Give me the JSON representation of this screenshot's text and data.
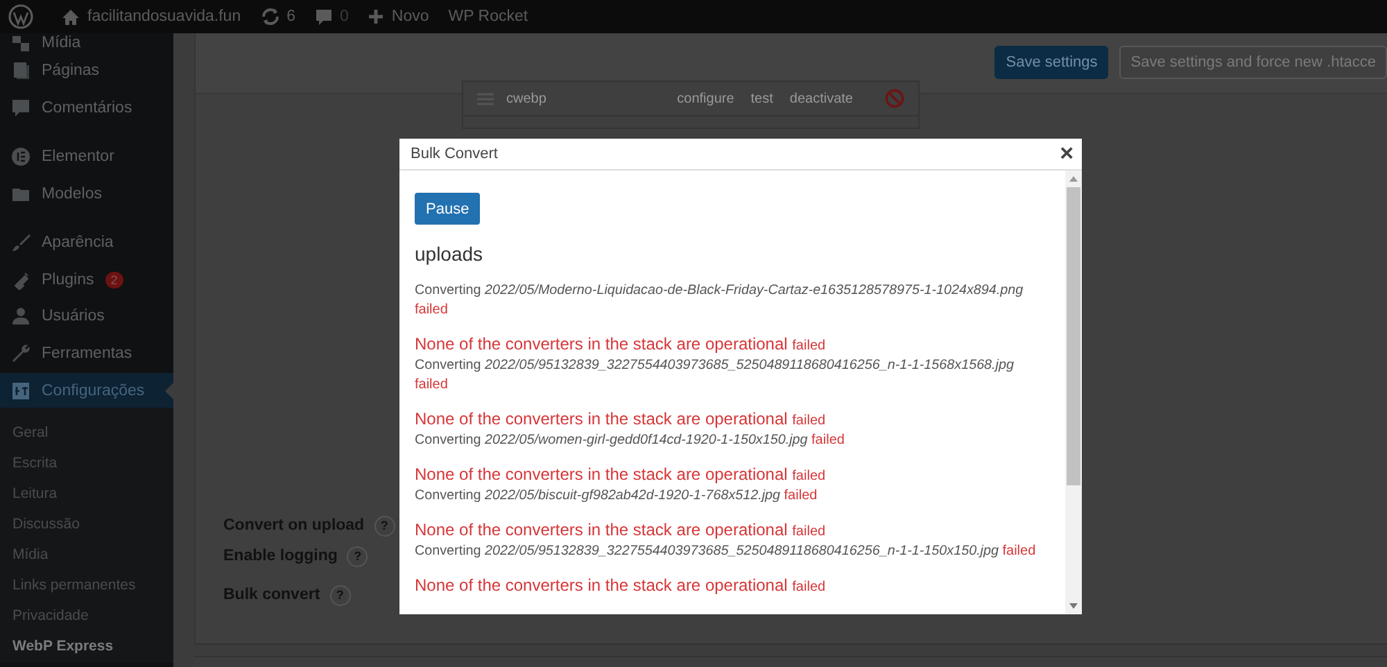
{
  "admin_bar": {
    "site": "facilitandosuavida.fun",
    "updates": "6",
    "comments": "0",
    "new": "Novo",
    "plugin": "WP Rocket"
  },
  "sidebar": {
    "groups": [
      {
        "items": [
          {
            "label": "Mídia",
            "selected": false
          },
          {
            "label": "Páginas",
            "selected": false
          },
          {
            "label": "Comentários",
            "selected": false
          }
        ]
      },
      {
        "items": [
          {
            "label": "Elementor",
            "selected": false
          },
          {
            "label": "Modelos",
            "selected": false
          }
        ]
      },
      {
        "items": [
          {
            "label": "Aparência",
            "selected": false
          },
          {
            "label": "Plugins",
            "selected": false,
            "badge": "2"
          },
          {
            "label": "Usuários",
            "selected": false
          },
          {
            "label": "Ferramentas",
            "selected": false
          },
          {
            "label": "Configurações",
            "selected": true
          }
        ]
      }
    ],
    "submenu": [
      {
        "label": "Geral",
        "selected": false
      },
      {
        "label": "Escrita",
        "selected": false
      },
      {
        "label": "Leitura",
        "selected": false
      },
      {
        "label": "Discussão",
        "selected": false
      },
      {
        "label": "Mídia",
        "selected": false
      },
      {
        "label": "Links permanentes",
        "selected": false
      },
      {
        "label": "Privacidade",
        "selected": false
      },
      {
        "label": "WebP Express",
        "selected": true
      }
    ]
  },
  "toolbar": {
    "buttons": [
      {
        "label": "Save settings",
        "kind": "primary"
      },
      {
        "label": "Save settings and force new .htacce",
        "kind": "secondary"
      }
    ]
  },
  "converter": {
    "name": "cwebp",
    "actions": [
      "configure",
      "test",
      "deactivate"
    ]
  },
  "settings": [
    {
      "label": "Convert on upload",
      "help": "?"
    },
    {
      "label": "Enable logging",
      "help": "?"
    },
    {
      "label": "Bulk convert",
      "help": "?"
    }
  ],
  "modal": {
    "title": "Bulk Convert",
    "close": "×",
    "pause": "Pause",
    "heading": "uploads",
    "log": [
      {
        "lines": [
          {
            "kind": "converting",
            "label": "Converting",
            "path": "2022/05/Moderno-Liquidacao-de-Black-Friday-Cartaz-e1635128578975-1-1024x894.png",
            "status": "failed"
          }
        ]
      },
      {
        "lines": [
          {
            "kind": "error",
            "text": "None of the converters in the stack are operational",
            "status": "failed"
          },
          {
            "kind": "converting",
            "label": "Converting",
            "path": "2022/05/95132839_3227554403973685_5250489118680416256_n-1-1-1568x1568.jpg",
            "status": "failed"
          }
        ]
      },
      {
        "lines": [
          {
            "kind": "error",
            "text": "None of the converters in the stack are operational",
            "status": "failed"
          },
          {
            "kind": "converting",
            "label": "Converting",
            "path": "2022/05/women-girl-gedd0f14cd-1920-1-150x150.jpg",
            "status": "failed"
          }
        ]
      },
      {
        "lines": [
          {
            "kind": "error",
            "text": "None of the converters in the stack are operational",
            "status": "failed"
          },
          {
            "kind": "converting",
            "label": "Converting",
            "path": "2022/05/biscuit-gf982ab42d-1920-1-768x512.jpg",
            "status": "failed"
          }
        ]
      },
      {
        "lines": [
          {
            "kind": "error",
            "text": "None of the converters in the stack are operational",
            "status": "failed"
          },
          {
            "kind": "converting",
            "label": "Converting",
            "path": "2022/05/95132839_3227554403973685_5250489118680416256_n-1-1-150x150.jpg",
            "status": "failed"
          }
        ]
      },
      {
        "lines": [
          {
            "kind": "error",
            "text": "None of the converters in the stack are operational",
            "status": "failed"
          }
        ]
      }
    ]
  }
}
